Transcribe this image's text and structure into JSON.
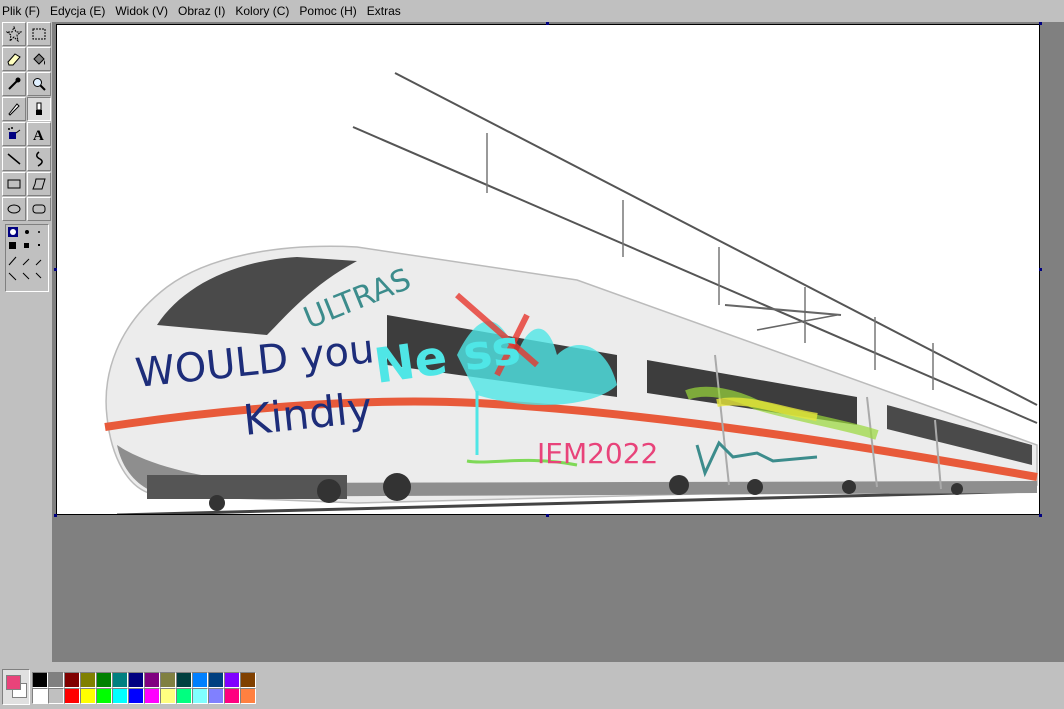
{
  "menu": {
    "items": [
      {
        "label": "Plik (F)"
      },
      {
        "label": "Edycja (E)"
      },
      {
        "label": "Widok (V)"
      },
      {
        "label": "Obraz (I)"
      },
      {
        "label": "Kolory (C)"
      },
      {
        "label": "Pomoc (H)"
      },
      {
        "label": "Extras"
      }
    ]
  },
  "toolbox": {
    "tools": [
      {
        "name": "free-select-icon",
        "glyph": "☆"
      },
      {
        "name": "rect-select-icon",
        "glyph": "⬚"
      },
      {
        "name": "eraser-icon",
        "glyph": "◇"
      },
      {
        "name": "fill-bucket-icon",
        "glyph": "▼"
      },
      {
        "name": "eyedropper-icon",
        "glyph": "╱"
      },
      {
        "name": "magnifier-icon",
        "glyph": "⚲"
      },
      {
        "name": "pencil-icon",
        "glyph": "✎"
      },
      {
        "name": "brush-icon",
        "glyph": "♜"
      },
      {
        "name": "airbrush-icon",
        "glyph": "♠"
      },
      {
        "name": "text-tool-icon",
        "glyph": "A"
      },
      {
        "name": "line-tool-icon",
        "glyph": "╲"
      },
      {
        "name": "curve-tool-icon",
        "glyph": "∫"
      },
      {
        "name": "rectangle-tool-icon",
        "glyph": "▭"
      },
      {
        "name": "polygon-tool-icon",
        "glyph": "⏢"
      },
      {
        "name": "ellipse-tool-icon",
        "glyph": "◯"
      },
      {
        "name": "rounded-rect-tool-icon",
        "glyph": "▢"
      }
    ]
  },
  "canvas": {
    "graffiti": {
      "line1": "WOULD you",
      "line2": "Kindly",
      "ultra": "ULTRAS",
      "tag": "IEM2022",
      "scribble": "Ne ss"
    }
  },
  "colors": {
    "foreground": "#e8437a",
    "background": "#ffffff",
    "palette_top": [
      "#000000",
      "#808080",
      "#800000",
      "#808000",
      "#008000",
      "#008080",
      "#000080",
      "#800080",
      "#808040",
      "#004040",
      "#0080ff",
      "#004080",
      "#8000ff",
      "#804000"
    ],
    "palette_bottom": [
      "#ffffff",
      "#c0c0c0",
      "#ff0000",
      "#ffff00",
      "#00ff00",
      "#00ffff",
      "#0000ff",
      "#ff00ff",
      "#ffff80",
      "#00ff80",
      "#80ffff",
      "#8080ff",
      "#ff0080",
      "#ff8040"
    ]
  }
}
